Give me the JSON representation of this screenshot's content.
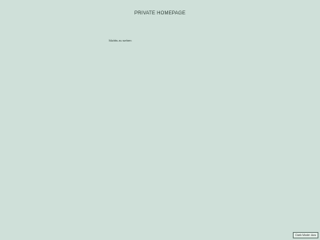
{
  "header": {
    "title": "PRIVATE HOMEPAGE"
  },
  "main": {
    "text": "Nichts zu sehen"
  },
  "footer": {
    "mode_button_label": "Dark Mode: Aus"
  },
  "colors": {
    "background": "#cfe0d9",
    "text": "#2e3d36"
  }
}
